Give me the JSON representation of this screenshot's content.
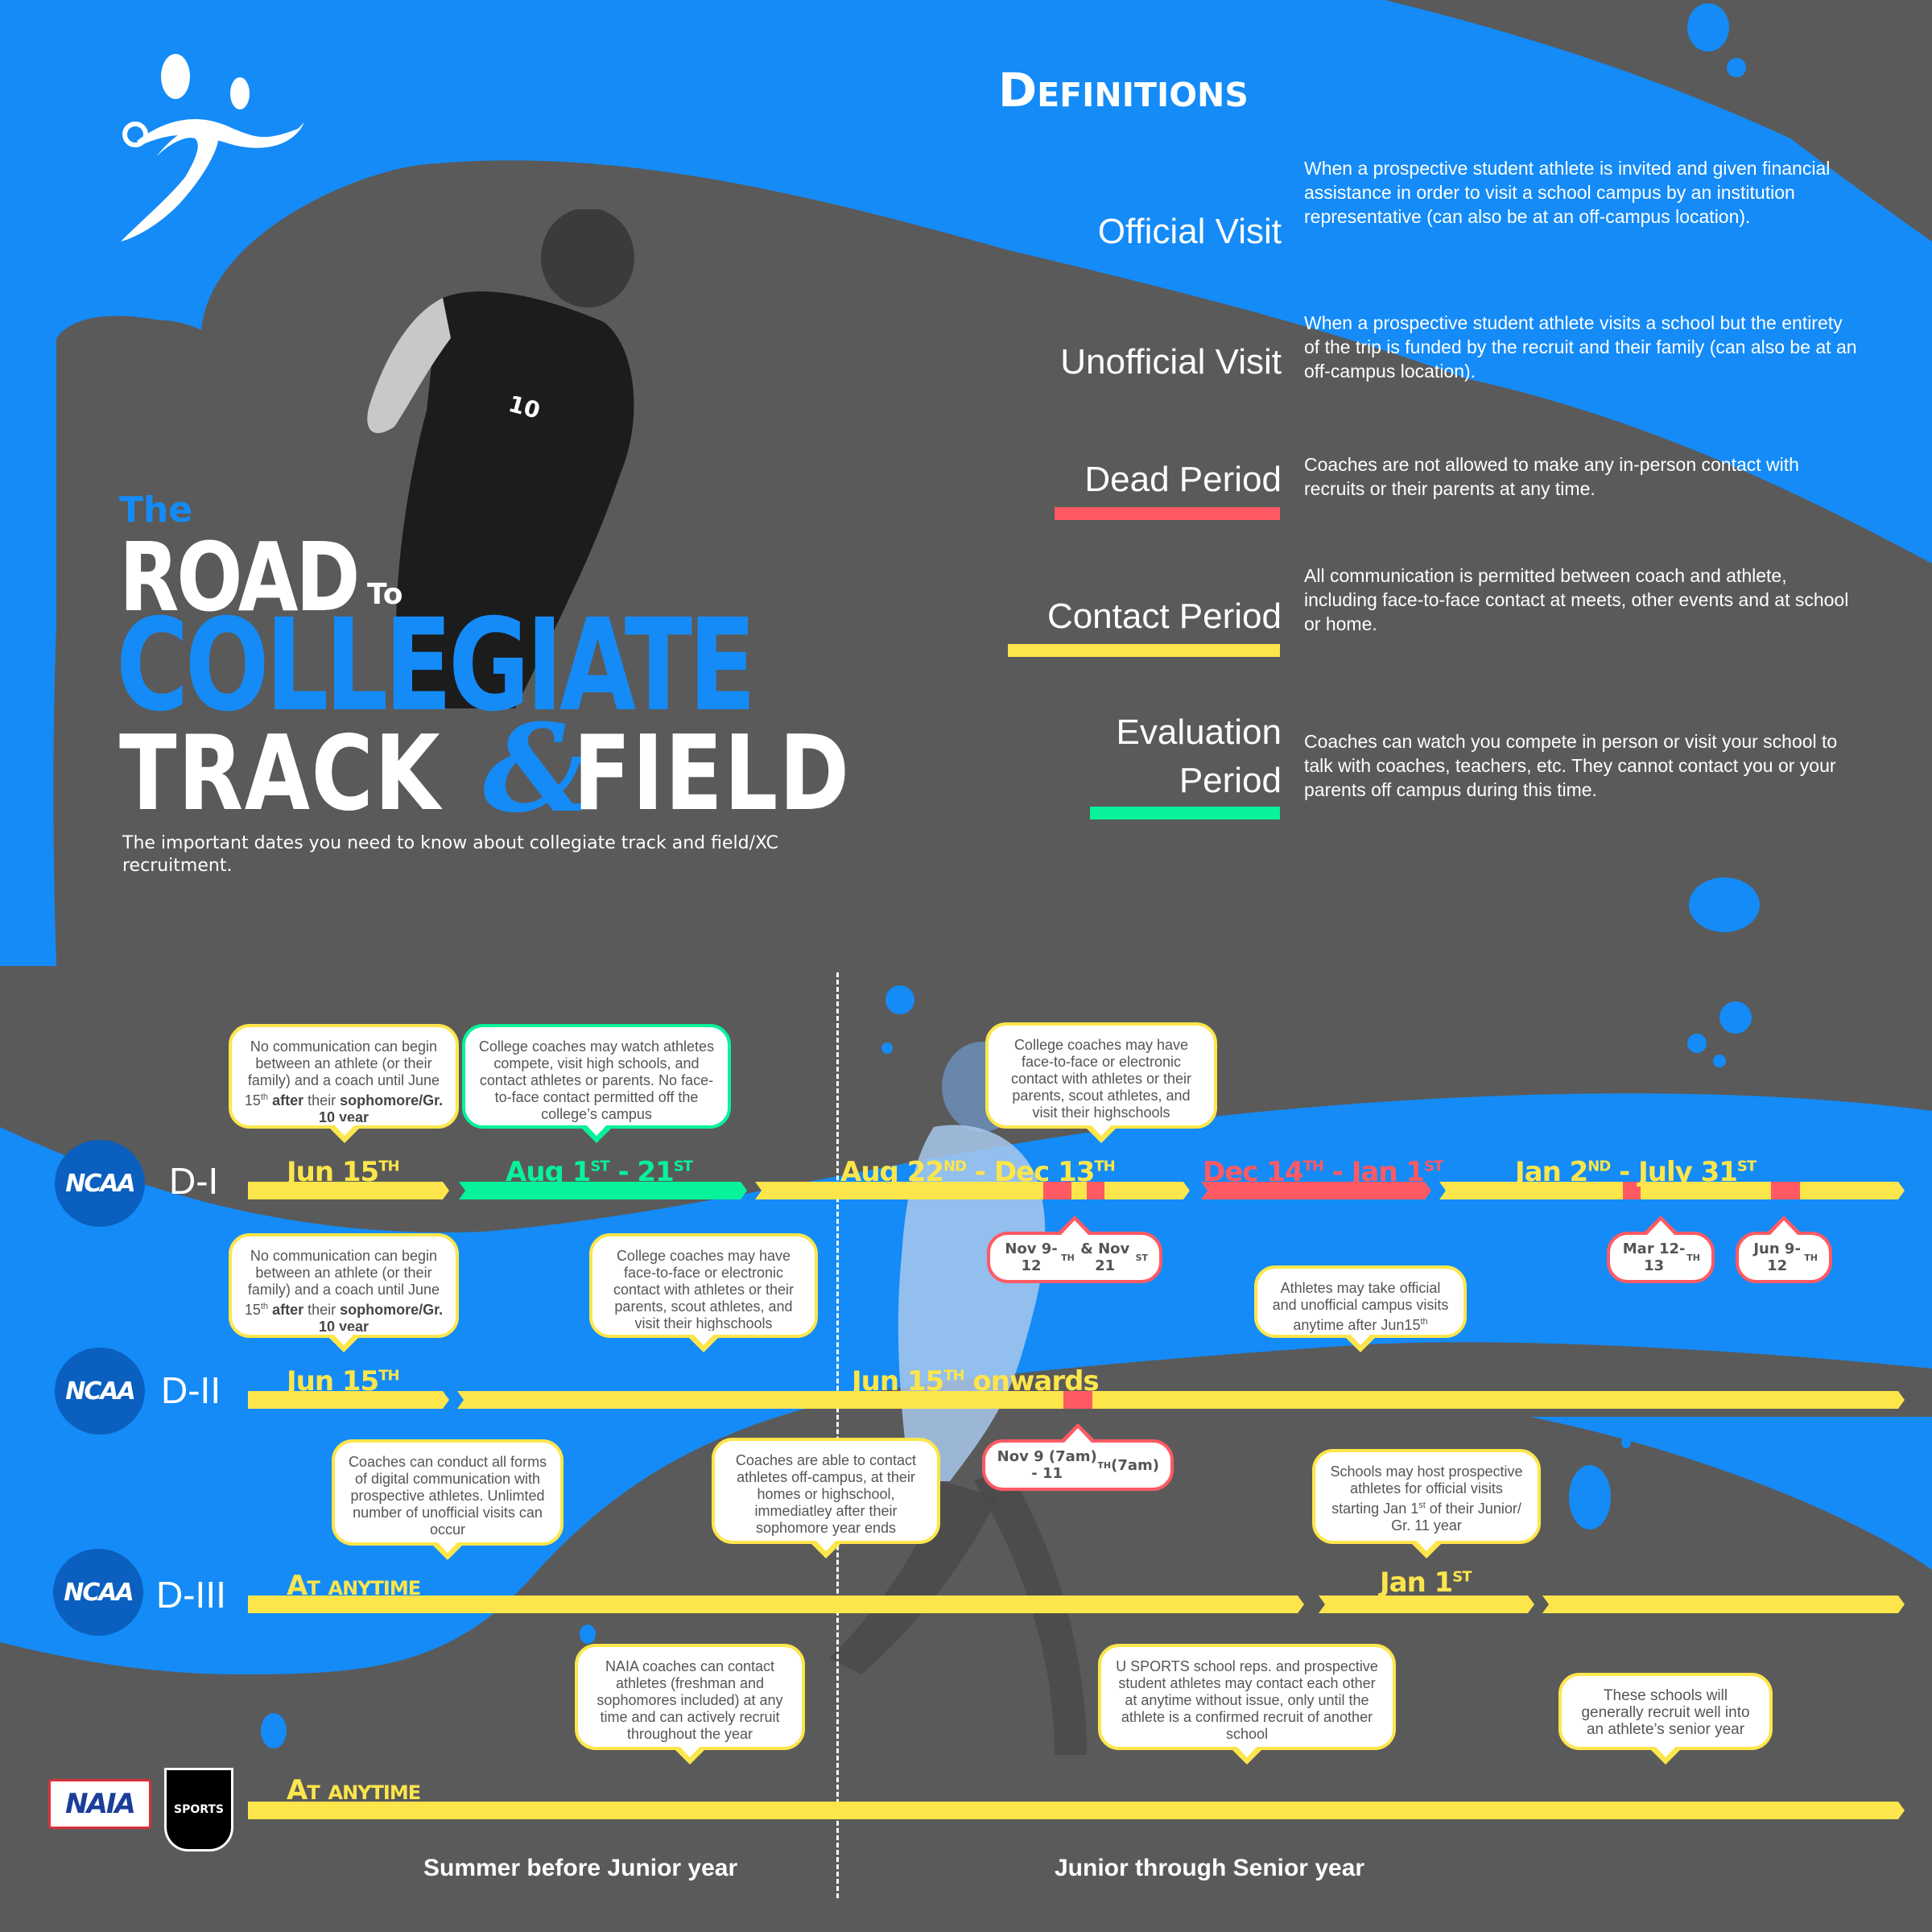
{
  "colors": {
    "brand_blue": "#148bf7",
    "dark_gray": "#5a5a5a",
    "contact_yellow": "#fde64b",
    "dead_red": "#ff5a63",
    "evaluation_green": "#07f29b",
    "ncaa_blue": "#0a5fbf"
  },
  "header": {
    "logo_icon": "runner-figure-icon",
    "title_the": "The",
    "title_road": "ROAD",
    "title_to": "To",
    "title_collegiate": "COLLEGIATE",
    "title_track": "TRACK",
    "title_amp": "&",
    "title_field": "FIELD",
    "subtitle": "The important dates you need to know about collegiate track and field/XC recruitment."
  },
  "definitions": {
    "heading": "Definitions",
    "items": [
      {
        "term": "Official Visit",
        "description": "When a prospective student athlete is invited and given financial assistance in order to visit a school campus by an institution representative (can also be at an off-campus location).",
        "color": null
      },
      {
        "term": "Unofficial Visit",
        "description": "When a prospective student athlete visits a school but the entirety of the trip is funded by the recruit and their family (can also be at an off-campus location).",
        "color": null
      },
      {
        "term": "Dead Period",
        "description": "Coaches are not allowed to make any in-person contact with recruits or their parents at any time.",
        "color": "#ff5a63"
      },
      {
        "term": "Contact Period",
        "description": "All communication is permitted between coach and athlete, including face-to-face contact at meets, other events and at school or home.",
        "color": "#fde64b"
      },
      {
        "term": "Evaluation Period",
        "term_line1": "Evaluation",
        "term_line2": "Period",
        "description": "Coaches can watch you compete in person or visit your school to talk with coaches, teachers, etc. They cannot contact you or your parents off campus during this time.",
        "color": "#07f29b"
      }
    ]
  },
  "timeline": {
    "rows": [
      {
        "org": "NCAA",
        "division": "D-I",
        "dates": [
          {
            "label": "Jun 15",
            "sup": "TH",
            "period": "contact"
          },
          {
            "label": "Aug 1",
            "sup": "ST",
            "label2": " - 21",
            "sup2": "ST",
            "period": "evaluation"
          },
          {
            "label": "Aug 22",
            "sup": "ND",
            "label2": " - Dec 13",
            "sup2": "TH",
            "period": "contact"
          },
          {
            "label": "Dec 14",
            "sup": "TH",
            "label2": " - Jan 1",
            "sup2": "ST",
            "period": "dead"
          },
          {
            "label": "Jan 2",
            "sup": "ND",
            "label2": " - July 31",
            "sup2": "ST",
            "period": "contact"
          }
        ],
        "notes_above": [
          {
            "text_parts": [
              "No communication can begin between an athlete (or their family) and a coach until June 15",
              "th",
              " after",
              " their ",
              "sophomore/Gr. 10 year"
            ],
            "border": "contact"
          },
          {
            "text": "College coaches may watch athletes compete, visit high schools, and contact athletes or parents. No face-to-face contact permitted off the college’s campus",
            "border": "evaluation"
          },
          {
            "text": "College coaches may have face-to-face or electronic contact with athletes or their parents, scout athletes, and visit their highschools",
            "border": "contact"
          }
        ],
        "dead_callouts": [
          {
            "label": "Nov 9-12",
            "sup": "TH",
            "label2": " & Nov 21",
            "sup2": "ST"
          },
          {
            "label": "Mar 12-13",
            "sup": "TH"
          },
          {
            "label": "Jun 9-12",
            "sup": "TH"
          }
        ]
      },
      {
        "org": "NCAA",
        "division": "D-II",
        "dates": [
          {
            "label": "Jun 15",
            "sup": "TH",
            "period": "contact"
          },
          {
            "label": "Jun 15",
            "sup": "TH",
            "label2": " onwards",
            "period": "contact"
          }
        ],
        "notes_above": [
          {
            "text_parts": [
              "No communication can begin between an athlete (or their family) and a coach until June 15",
              "th",
              " after",
              " their ",
              "sophomore/Gr. 10 year"
            ],
            "border": "contact"
          },
          {
            "text": "College coaches may have face-to-face or electronic contact with athletes or their parents, scout athletes, and visit their highschools",
            "border": "contact"
          },
          {
            "text_parts": [
              "Athletes may take official and unofficial campus visits anytime after Jun15",
              "th"
            ],
            "border": "contact"
          }
        ],
        "dead_callouts": [
          {
            "label": "Nov 9 (7am) - 11",
            "sup": "TH",
            "label2": " (7am)"
          }
        ]
      },
      {
        "org": "NCAA",
        "division": "D-III",
        "dates": [
          {
            "label": "At anytime",
            "period": "contact"
          },
          {
            "label": "Jan 1",
            "sup": "ST",
            "period": "contact"
          }
        ],
        "notes_above": [
          {
            "text": "Coaches can conduct all forms of digital communication with prospective athletes. Unlimted number of unofficial visits can occur",
            "border": "contact"
          },
          {
            "text": "Coaches are able to contact athletes off-campus, at their homes or highschool, immediatley after their sophomore year ends",
            "border": "contact"
          },
          {
            "text_parts": [
              "Schools may host prospective athletes for official visits starting Jan 1",
              "st",
              " of their Junior/ Gr. 11 year"
            ],
            "border": "contact"
          }
        ]
      },
      {
        "org": "NAIA / U SPORTS",
        "org_logo_1": "NAIA",
        "org_logo_2": "SPORTS",
        "dates": [
          {
            "label": "At anytime",
            "period": "contact"
          }
        ],
        "notes_above": [
          {
            "text": "NAIA coaches can contact athletes (freshman and sophomores included) at any time and can actively recruit throughout the year",
            "border": "contact"
          },
          {
            "text": "U SPORTS school reps. and prospective student athletes may contact each other at anytime without issue, only until the athlete is a confirmed recruit of another school",
            "border": "contact"
          },
          {
            "text": "These schools will generally recruit well into an athlete’s senior year",
            "border": "contact"
          }
        ]
      }
    ],
    "phases": [
      {
        "label": "Summer before Junior year"
      },
      {
        "label": "Junior through Senior year"
      }
    ]
  }
}
